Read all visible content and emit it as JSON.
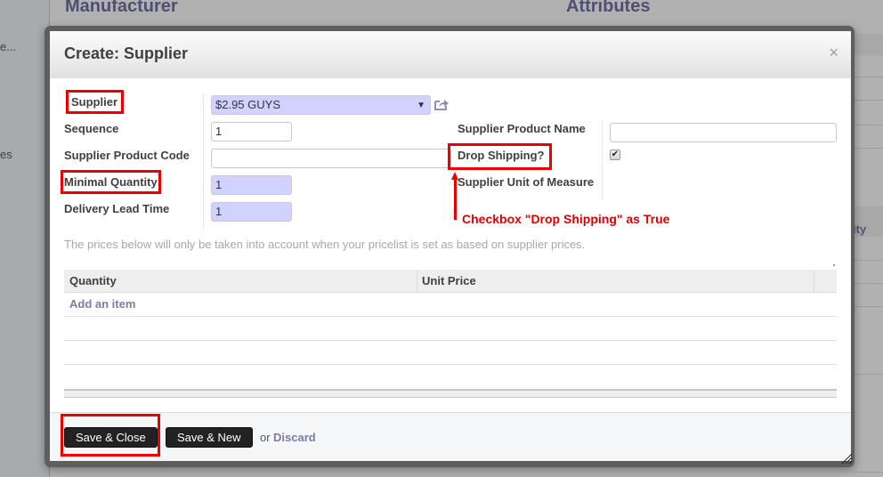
{
  "background": {
    "left_texts": [
      "e...",
      "es"
    ],
    "headings": [
      "Manufacturer",
      "Attributes"
    ],
    "right_partial_text": "ity"
  },
  "dialog": {
    "title": "Create: Supplier",
    "close_icon": "close-icon",
    "close_glyph": "×",
    "fields_left": {
      "supplier": {
        "label": "Supplier",
        "value": "$2.95 GUYS",
        "required": true
      },
      "sequence": {
        "label": "Sequence",
        "value": "1"
      },
      "supplier_product_code": {
        "label": "Supplier Product Code",
        "value": ""
      },
      "minimal_quantity": {
        "label": "Minimal Quantity",
        "value": "1",
        "required": true
      },
      "delivery_lead_time": {
        "label": "Delivery Lead Time",
        "value": "1",
        "required": true
      }
    },
    "fields_right": {
      "supplier_product_name": {
        "label": "Supplier Product Name",
        "value": ""
      },
      "drop_shipping": {
        "label": "Drop Shipping?",
        "checked": true,
        "check_glyph": "✔"
      },
      "supplier_uom": {
        "label": "Supplier Unit of Measure",
        "value": ""
      }
    },
    "help_text": "The prices below will only be taken into account when your pricelist is set as based on supplier prices.",
    "price_table": {
      "columns": [
        "Quantity",
        "Unit Price"
      ],
      "add_item_label": "Add an item",
      "rows": []
    },
    "footer": {
      "save_close_label": "Save & Close",
      "save_new_label": "Save & New",
      "or_label": "or",
      "discard_label": "Discard"
    }
  },
  "annotations": {
    "drop_shipping_note": "Checkbox \"Drop Shipping\" as True",
    "highlight_color": "#ee0000"
  },
  "colors": {
    "required_field_bg": "#d2d2ff",
    "link": "#7c7bad",
    "button_bg": "#222222"
  }
}
